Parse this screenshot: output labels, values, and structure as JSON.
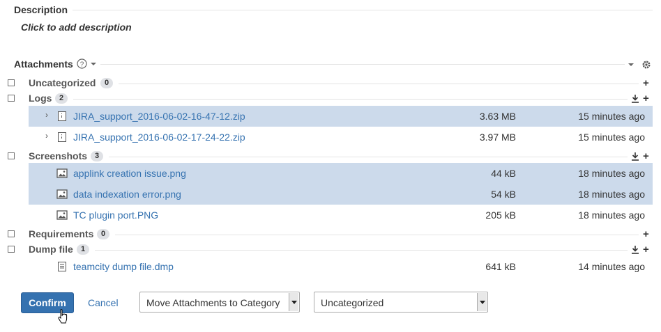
{
  "description": {
    "title": "Description",
    "hint": "Click to add description"
  },
  "attachments": {
    "title": "Attachments"
  },
  "categories": [
    {
      "label": "Uncategorized",
      "count": "0"
    },
    {
      "label": "Logs",
      "count": "2"
    },
    {
      "label": "Screenshots",
      "count": "3"
    },
    {
      "label": "Requirements",
      "count": "0"
    },
    {
      "label": "Dump file",
      "count": "1"
    }
  ],
  "files": [
    {
      "name": "JIRA_support_2016-06-02-16-47-12.zip",
      "size": "3.63 MB",
      "time": "15 minutes ago",
      "icon": "archive-icon",
      "selected": true
    },
    {
      "name": "JIRA_support_2016-06-02-17-24-22.zip",
      "size": "3.97 MB",
      "time": "15 minutes ago",
      "icon": "archive-icon",
      "selected": false
    },
    {
      "name": "applink creation issue.png",
      "size": "44 kB",
      "time": "18 minutes ago",
      "icon": "image-icon",
      "selected": true
    },
    {
      "name": "data indexation error.png",
      "size": "54 kB",
      "time": "18 minutes ago",
      "icon": "image-icon",
      "selected": true
    },
    {
      "name": "TC plugin port.PNG",
      "size": "205 kB",
      "time": "18 minutes ago",
      "icon": "image-icon",
      "selected": false
    },
    {
      "name": "teamcity dump file.dmp",
      "size": "641 kB",
      "time": "14 minutes ago",
      "icon": "document-icon",
      "selected": false
    }
  ],
  "actions": {
    "confirm_label": "Confirm",
    "cancel_label": "Cancel",
    "operation_select": "Move Attachments to Category",
    "category_select": "Uncategorized"
  },
  "colors": {
    "accent": "#3572b0",
    "selected_row": "#ccdaeb",
    "badge": "#dfe1e5"
  }
}
